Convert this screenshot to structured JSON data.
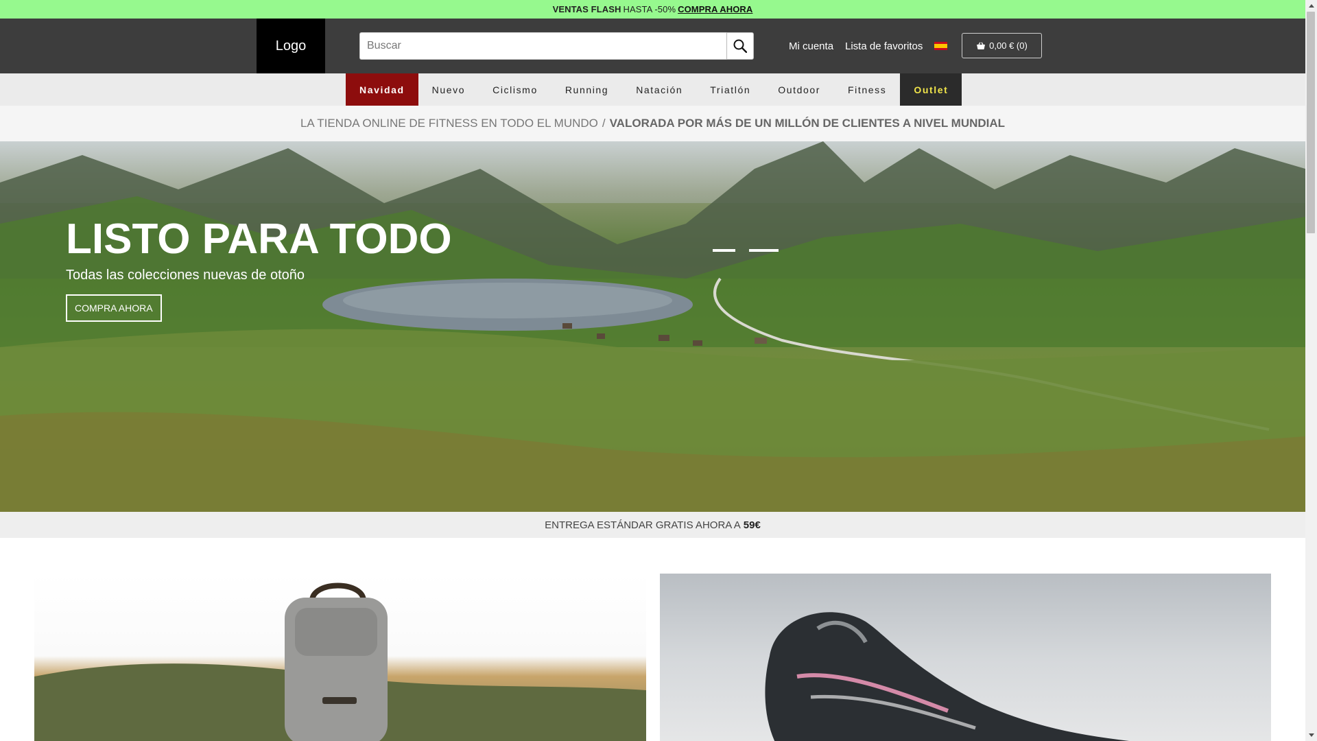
{
  "promo": {
    "strong": "VENTAS FLASH",
    "text": "HASTA -50%",
    "link": "COMPRA AHORA"
  },
  "header": {
    "logo": "Logo",
    "search": {
      "placeholder": "Buscar",
      "value": ""
    },
    "account": "Mi cuenta",
    "wishlist": "Lista de favoritos",
    "language_icon": "spain-flag-icon",
    "cart": "0,00 € (0)"
  },
  "nav": {
    "items": [
      {
        "label": "Navidad"
      },
      {
        "label": "Nuevo"
      },
      {
        "label": "Ciclismo"
      },
      {
        "label": "Running"
      },
      {
        "label": "Natación"
      },
      {
        "label": "Triatlón"
      },
      {
        "label": "Outdoor"
      },
      {
        "label": "Fitness"
      },
      {
        "label": "Outlet"
      }
    ]
  },
  "tagline": {
    "part1": "LA TIENDA ONLINE DE FITNESS EN TODO EL MUNDO",
    "separator": "/",
    "part2": "VALORADA POR MÁS DE UN MILLÓN DE CLIENTES A NIVEL MUNDIAL"
  },
  "hero": {
    "title": "LISTO PARA TODO",
    "subtitle": "Todas las colecciones nuevas de otoño",
    "button": "COMPRA AHORA",
    "slides": 2,
    "active_slide": 2
  },
  "shipping": {
    "text": "ENTREGA ESTÁNDAR GRATIS AHORA A",
    "amount": "59€"
  },
  "colors": {
    "promo_bar": "#96f98e",
    "header": "#3d3d3d",
    "nav_active": "#8d0d0d",
    "outlet_text": "#f0e44a"
  }
}
